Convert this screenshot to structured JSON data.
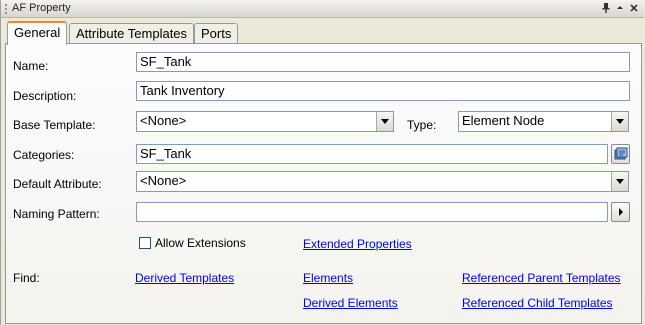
{
  "window": {
    "title": "AF Property"
  },
  "tabs": [
    {
      "label": "General"
    },
    {
      "label": "Attribute Templates"
    },
    {
      "label": "Ports"
    }
  ],
  "form": {
    "name": {
      "label": "Name:",
      "value": "SF_Tank"
    },
    "description": {
      "label": "Description:",
      "value": "Tank Inventory"
    },
    "base_template": {
      "label": "Base Template:",
      "value": "<None>"
    },
    "type": {
      "label": "Type:",
      "value": "Element Node"
    },
    "categories": {
      "label": "Categories:",
      "value": "SF_Tank"
    },
    "default_attribute": {
      "label": "Default Attribute:",
      "value": "<None>"
    },
    "naming_pattern": {
      "label": "Naming Pattern:",
      "value": ""
    },
    "allow_extensions": {
      "label": "Allow Extensions",
      "checked": false
    },
    "extended_properties": "Extended Properties"
  },
  "find": {
    "label": "Find:",
    "links": {
      "derived_templates": "Derived Templates",
      "elements": "Elements",
      "derived_elements": "Derived Elements",
      "referenced_parent_templates": "Referenced Parent Templates",
      "referenced_child_templates": "Referenced Child Templates"
    }
  },
  "icons": {
    "pin": "pin-icon",
    "collapse": "caret-up-icon",
    "close": "close-icon",
    "categories_browse": "browse-categories-icon"
  }
}
